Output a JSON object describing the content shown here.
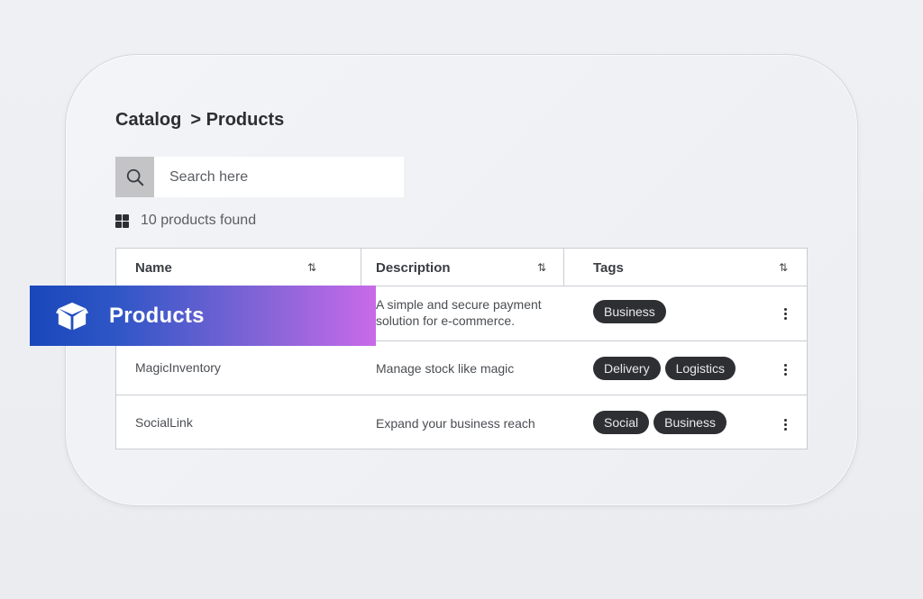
{
  "breadcrumb": {
    "root": "Catalog",
    "current": "> Products"
  },
  "search": {
    "placeholder": "Search here",
    "value": ""
  },
  "results": {
    "count_label": "10 products found"
  },
  "table": {
    "columns": [
      {
        "label": "Name",
        "sort": "⇅"
      },
      {
        "label": "Description",
        "sort": "⇅"
      },
      {
        "label": "Tags",
        "sort": "⇅"
      }
    ],
    "rows": [
      {
        "name": "",
        "description": "A simple and secure payment solution for e-commerce.",
        "tags": [
          "Business"
        ]
      },
      {
        "name": "MagicInventory",
        "description": "Manage stock like magic",
        "tags": [
          "Delivery",
          "Logistics"
        ]
      },
      {
        "name": "SocialLink",
        "description": "Expand your business reach",
        "tags": [
          "Social",
          "Business"
        ]
      }
    ]
  },
  "banner": {
    "title": "Products",
    "icon": "box-icon"
  },
  "icons": {
    "search": "search-icon",
    "grid": "grid-icon",
    "row_menu": "kebab-menu-icon"
  },
  "colors": {
    "tag_bg": "#2e2f33",
    "banner_start": "#1947ba",
    "banner_end": "#c96ae8"
  }
}
